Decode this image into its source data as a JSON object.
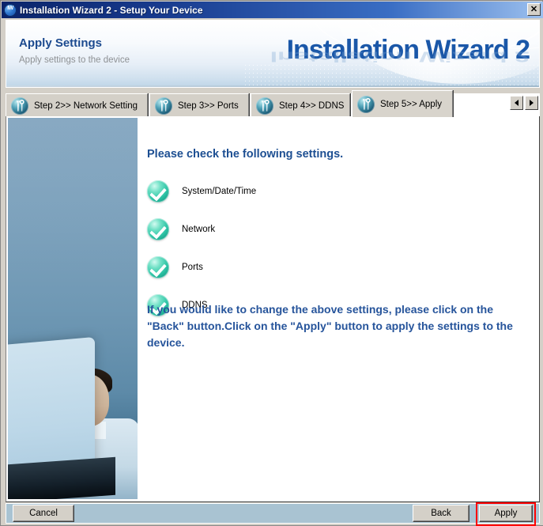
{
  "window": {
    "title": "Installation Wizard 2 - Setup Your Device",
    "icon": "app-icon-iw2",
    "close_label": "✕"
  },
  "banner": {
    "title": "Apply Settings",
    "subtitle": "Apply settings to the device",
    "brand": "Installation Wizard 2"
  },
  "tabs": [
    {
      "label": "Step 2>> Network Setting",
      "icon": "tools-icon",
      "active": false
    },
    {
      "label": "Step 3>> Ports",
      "icon": "tools-icon",
      "active": false
    },
    {
      "label": "Step 4>> DDNS",
      "icon": "tools-icon",
      "active": false
    },
    {
      "label": "Step 5>> Apply",
      "icon": "tools-icon",
      "active": true
    }
  ],
  "tab_scroll": {
    "prev_label": "◄",
    "next_label": "►"
  },
  "main": {
    "heading": "Please check the following settings.",
    "checklist": [
      {
        "label": "System/Date/Time",
        "icon": "check-circle-icon",
        "checked": true
      },
      {
        "label": "Network",
        "icon": "check-circle-icon",
        "checked": true
      },
      {
        "label": "Ports",
        "icon": "check-circle-icon",
        "checked": true
      },
      {
        "label": "DDNS",
        "icon": "check-circle-icon",
        "checked": true
      }
    ],
    "instructions": "If you would like to change the above settings, please click on the \"Back\" button.Click on the \"Apply\" button to apply the settings to the device."
  },
  "footer": {
    "cancel_label": "Cancel",
    "back_label": "Back",
    "apply_label": "Apply"
  },
  "colors": {
    "titlebar_start": "#0a246a",
    "titlebar_end": "#9cc0ee",
    "brand_blue": "#1a57a8",
    "heading_blue": "#1d4f92",
    "paragraph_blue": "#26549b",
    "footer_bar": "#a9c3d2",
    "dialog_face": "#d4d0c8",
    "highlight_red": "#ff0000",
    "check_green": "#2fc4a6",
    "tab_icon_teal": "#4d9fb5"
  }
}
